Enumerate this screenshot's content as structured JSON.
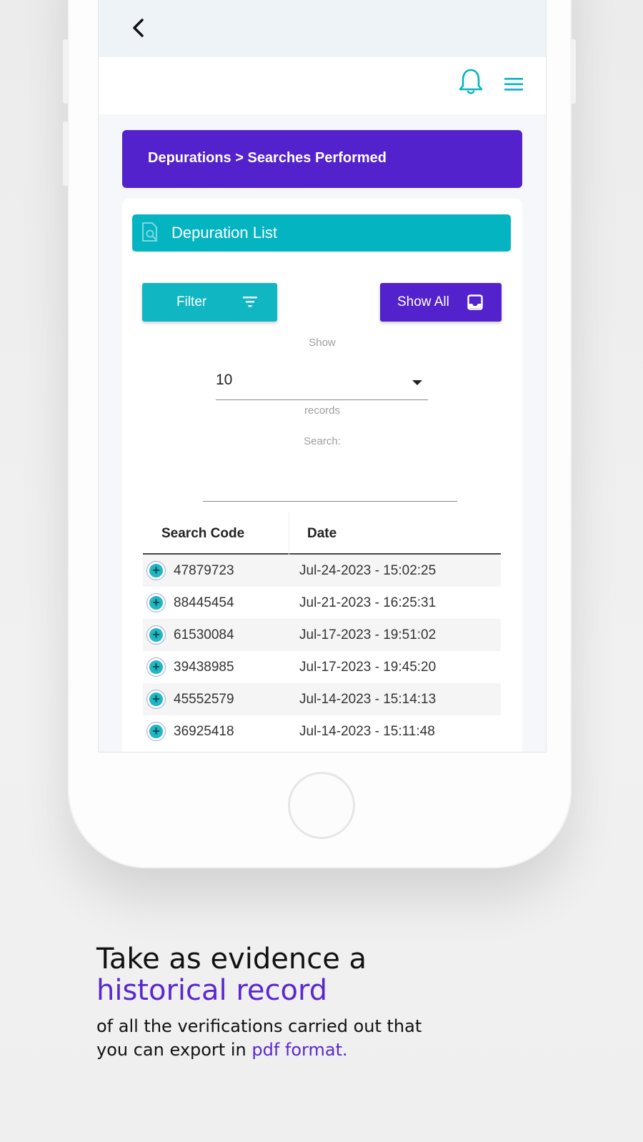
{
  "appbar": {
    "notifications_icon": "bell-icon",
    "menu_icon": "hamburger-icon"
  },
  "breadcrumb": "Depurations > Searches Performed",
  "card": {
    "title": "Depuration List",
    "filter_label": "Filter",
    "show_all_label": "Show All",
    "show_label": "Show",
    "page_size": "10",
    "records_label": "records",
    "search_label": "Search:",
    "search_value": ""
  },
  "table": {
    "columns": [
      "Search Code",
      "Date"
    ],
    "rows": [
      {
        "code": "47879723",
        "date": "Jul-24-2023 - 15:02:25"
      },
      {
        "code": "88445454",
        "date": "Jul-21-2023 - 16:25:31"
      },
      {
        "code": "61530084",
        "date": "Jul-17-2023 - 19:51:02"
      },
      {
        "code": "39438985",
        "date": "Jul-17-2023 - 19:45:20"
      },
      {
        "code": "45552579",
        "date": "Jul-14-2023 - 15:14:13"
      },
      {
        "code": "36925418",
        "date": "Jul-14-2023 - 15:11:48"
      }
    ]
  },
  "tagline": {
    "line1": "Take as evidence a",
    "line2": "historical record",
    "line3a": "of all the verifications carried out that",
    "line3b": "you can export in ",
    "line3_highlight": "pdf format."
  },
  "colors": {
    "purple": "#5322cc",
    "teal": "#05b4c1"
  }
}
